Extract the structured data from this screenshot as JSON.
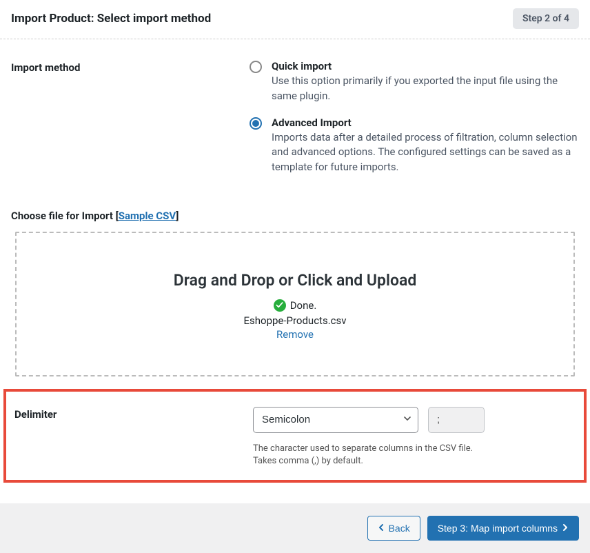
{
  "header": {
    "title": "Import Product: Select import method",
    "step": "Step 2 of 4"
  },
  "import_method": {
    "label": "Import method",
    "options": [
      {
        "title": "Quick import",
        "desc": "Use this option primarily if you exported the input file using the same plugin.",
        "checked": false
      },
      {
        "title": "Advanced Import",
        "desc": "Imports data after a detailed process of filtration, column selection and advanced options. The configured settings can be saved as a template for future imports.",
        "checked": true
      }
    ]
  },
  "file_section": {
    "label_prefix": "Choose file for Import [",
    "link_text": "Sample CSV",
    "label_suffix": "]"
  },
  "dropzone": {
    "title": "Drag and Drop or Click and Upload",
    "done": "Done.",
    "filename": "Eshoppe-Products.csv",
    "remove": "Remove"
  },
  "delimiter": {
    "label": "Delimiter",
    "selected": "Semicolon",
    "char": ";",
    "help1": "The character used to separate columns in the CSV file.",
    "help2": "Takes comma (,) by default."
  },
  "footer": {
    "back": "Back",
    "next": "Step 3: Map import columns"
  }
}
